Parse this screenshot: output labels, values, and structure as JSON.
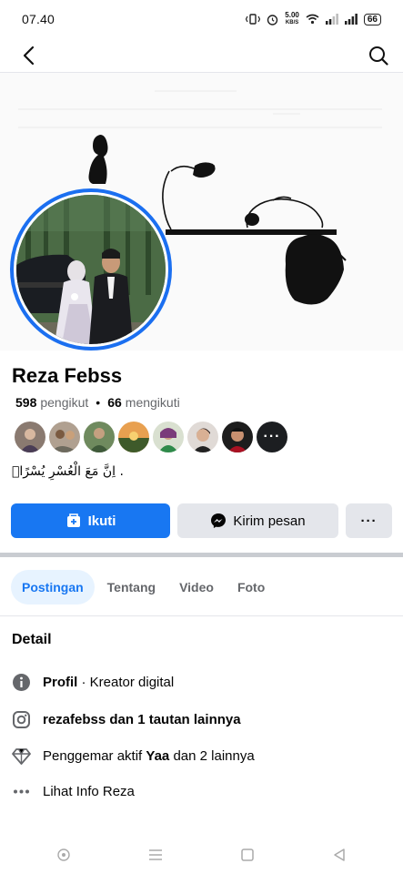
{
  "status_bar": {
    "time": "07.40",
    "net_speed_value": "5.00",
    "net_speed_unit": "KB/S",
    "battery": "66"
  },
  "profile": {
    "name": "Reza Febss",
    "followers_count": "598",
    "followers_label": "pengikut",
    "following_count": "66",
    "following_label": "mengikuti",
    "bio": "اِنَّ مَعَ الْعُسْرِ يُسْرًاۗ ."
  },
  "actions": {
    "follow_label": "Ikuti",
    "message_label": "Kirim pesan",
    "more_label": "···"
  },
  "tabs": [
    {
      "label": "Postingan",
      "active": true
    },
    {
      "label": "Tentang",
      "active": false
    },
    {
      "label": "Video",
      "active": false
    },
    {
      "label": "Foto",
      "active": false
    }
  ],
  "detail": {
    "title": "Detail",
    "profile_bold": "Profil",
    "profile_rest": " · Kreator digital",
    "instagram_bold": "rezafebss dan 1 tautan lainnya",
    "fan_prefix": "Penggemar aktif ",
    "fan_bold": "Yaa",
    "fan_suffix": " dan 2 lainnya",
    "see_info": "Lihat Info Reza"
  },
  "colors": {
    "accent": "#1877f2",
    "ring": "#1b6ff0",
    "tab_active_bg": "#e7f3ff",
    "button_gray": "#e4e6eb"
  },
  "icons": {
    "back": "back-arrow-icon",
    "search": "search-icon",
    "follow": "add-friend-icon",
    "messenger": "messenger-icon",
    "info": "info-icon",
    "instagram": "instagram-icon",
    "diamond": "diamond-icon",
    "more": "more-dots-icon"
  }
}
